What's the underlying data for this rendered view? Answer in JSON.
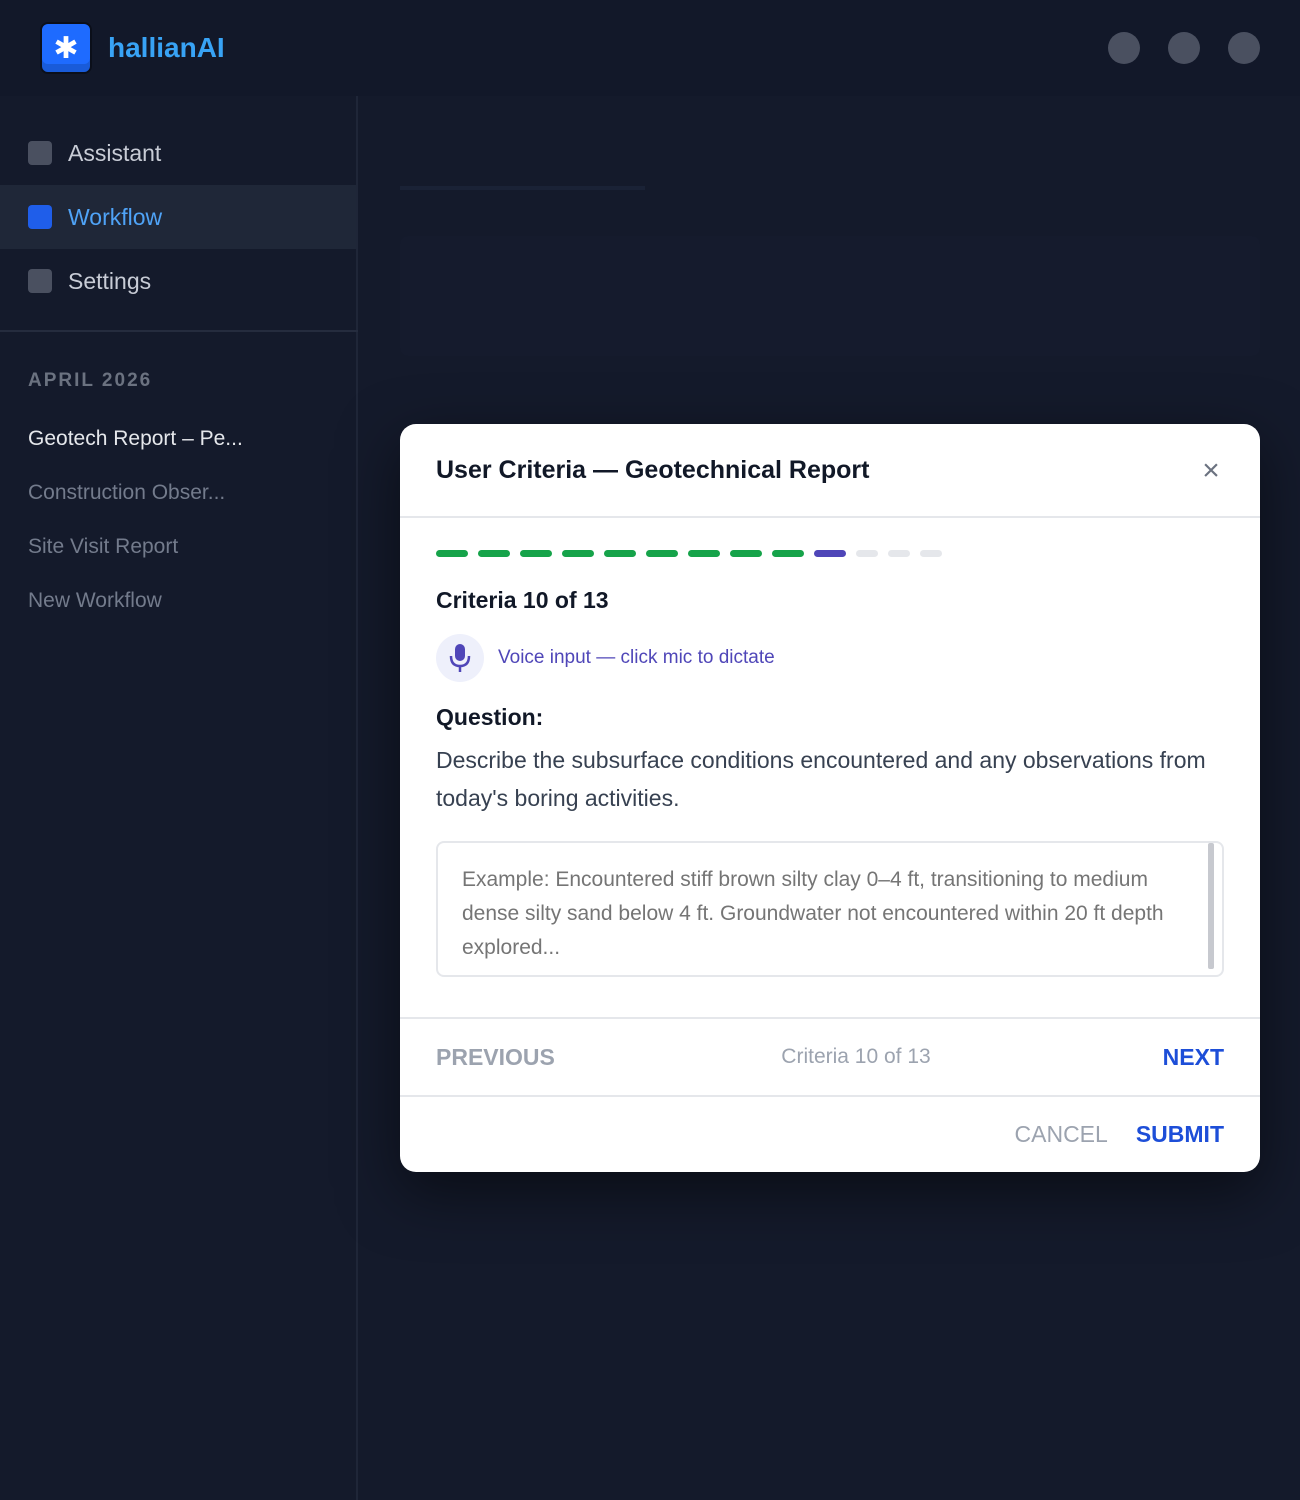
{
  "app": {
    "brand": "hallianAI",
    "logo_icon": "sparkle-icon"
  },
  "sidebar": {
    "nav": [
      {
        "label": "Assistant",
        "active": false
      },
      {
        "label": "Workflow",
        "active": true
      },
      {
        "label": "Settings",
        "active": false
      }
    ],
    "section_label": "APRIL 2026",
    "history": [
      "Geotech Report – Pe...",
      "Construction Obser...",
      "Site Visit Report",
      "New Workflow"
    ]
  },
  "modal": {
    "title": "User Criteria — Geotechnical Report",
    "close_glyph": "×",
    "progress": {
      "completed": 9,
      "current": 10,
      "total": 13
    },
    "criteria_label": "Criteria 10 of 13",
    "voice_hint": "Voice input — click mic to dictate",
    "question_label": "Question:",
    "question_text": "Describe the subsurface conditions encountered and any observations from today's boring activities.",
    "answer_placeholder": "Example: Encountered stiff brown silty clay 0–4 ft, transitioning to medium dense silty sand below 4 ft. Groundwater not encountered within 20 ft depth explored...",
    "previous_label": "PREVIOUS",
    "counter_label": "Criteria 10 of 13",
    "next_label": "NEXT",
    "cancel_label": "CANCEL",
    "submit_label": "SUBMIT"
  },
  "colors": {
    "done": "#16a34a",
    "current": "#4f46b8",
    "todo": "#e5e7eb",
    "accent": "#1d4ed8"
  }
}
